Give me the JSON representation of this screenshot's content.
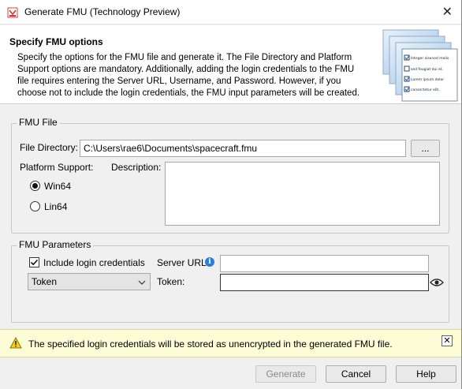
{
  "window": {
    "title": "Generate FMU (Technology Preview)",
    "close_glyph": "✕"
  },
  "header": {
    "title": "Specify FMU options",
    "description": "Specify the options for the FMU file and generate it. The File Directory and Platform Support options are mandatory. Additionally, adding the login credentials to the FMU file requires entering the Server URL, Username, and Password. However, if you choose not to include the login credentials, the FMU input parameters will be created.",
    "graphic_lines": [
      "Integer sisenod molis",
      "sed feugiat dui et.",
      "Lorem ipsum dolor",
      "consectetur elit."
    ]
  },
  "fmu_file": {
    "group_label": "FMU File",
    "directory_label": "File Directory:",
    "directory_value": "C:\\Users\\rae6\\Documents\\spacecraft.fmu",
    "browse_label": "...",
    "platform_label": "Platform Support:",
    "description_label": "Description:",
    "platforms": [
      {
        "label": "Win64",
        "selected": true
      },
      {
        "label": "Lin64",
        "selected": false
      }
    ]
  },
  "fmu_parameters": {
    "group_label": "FMU Parameters",
    "include_credentials_label": "Include login credentials",
    "include_credentials_checked": true,
    "server_url_label": "Server URL:",
    "server_url_value": "",
    "auth_type": "Token",
    "token_label": "Token:",
    "token_value": ""
  },
  "warning": {
    "message": "The specified login credentials will be stored as unencrypted in the generated FMU file.",
    "close_glyph": "✕"
  },
  "footer": {
    "generate_label": "Generate",
    "cancel_label": "Cancel",
    "help_label": "Help"
  },
  "icons": {
    "app": "app-icon",
    "info": "info-icon",
    "warning": "warning-icon",
    "eye": "eye-icon"
  }
}
